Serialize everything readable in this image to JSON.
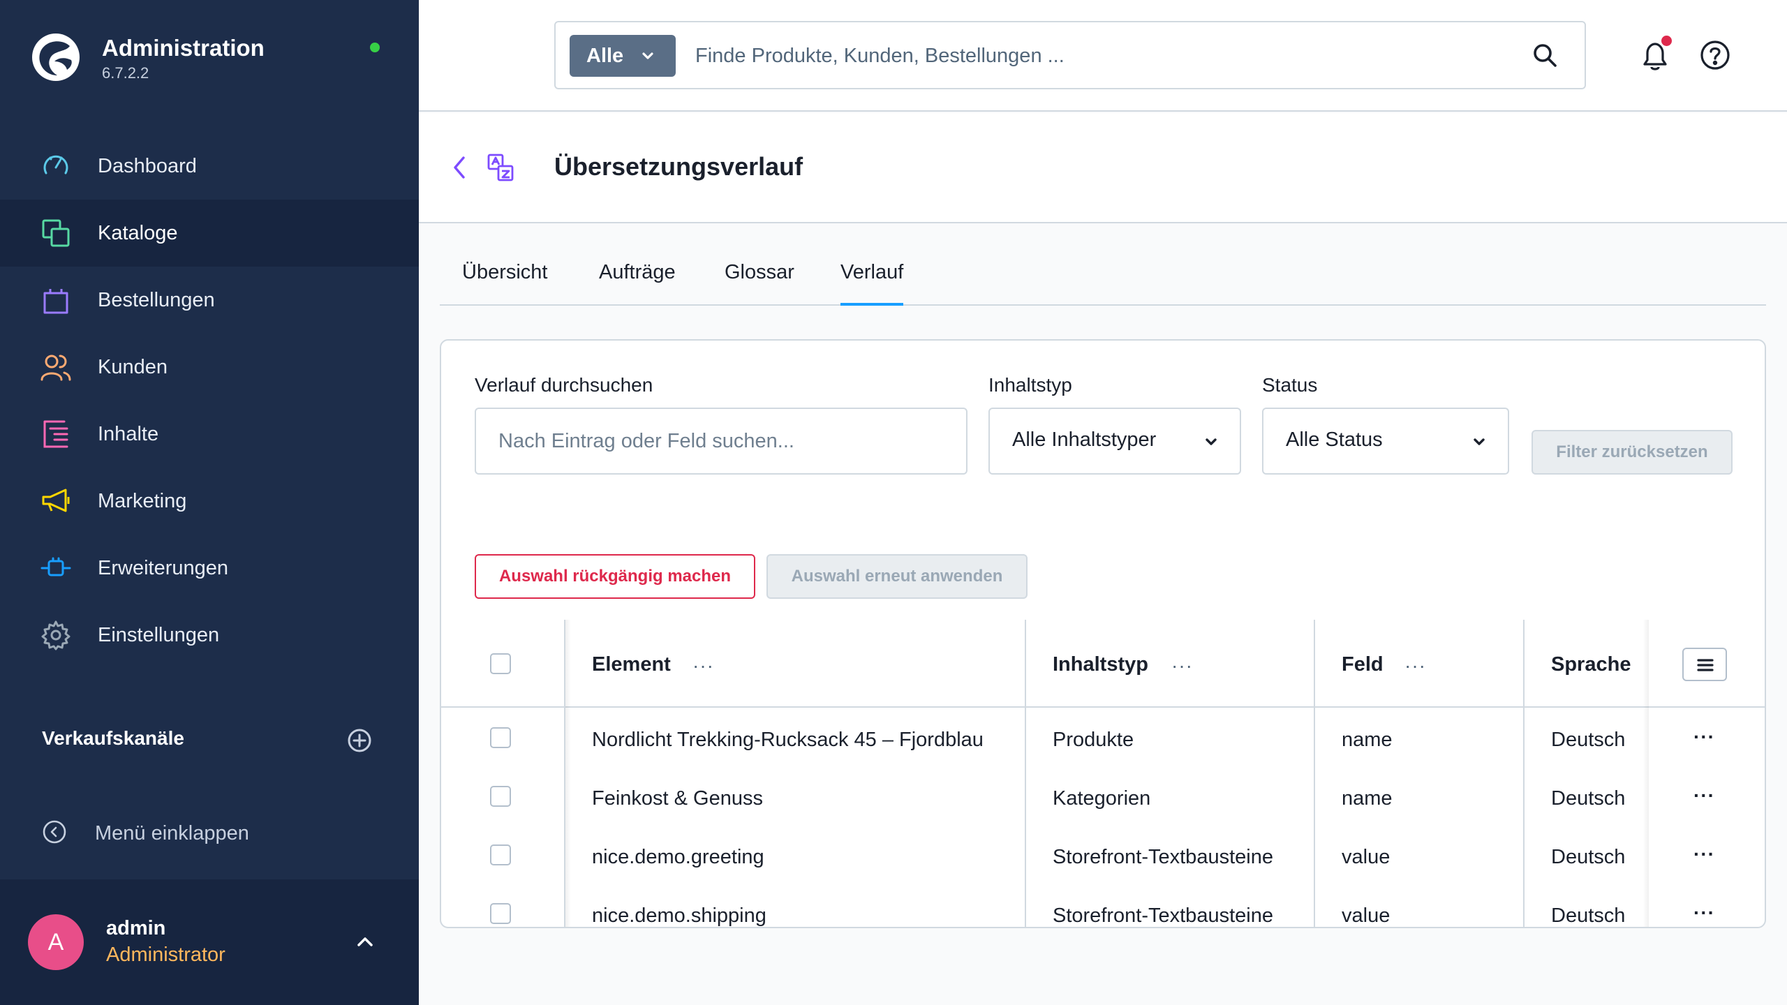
{
  "app": {
    "title": "Administration",
    "version": "6.7.2.2",
    "status_color": "#37d046"
  },
  "sidebar": {
    "items": [
      {
        "label": "Dashboard",
        "icon": "gauge-icon",
        "color": "#5bc9e8"
      },
      {
        "label": "Kataloge",
        "icon": "catalog-icon",
        "color": "#57d9a3",
        "active": true
      },
      {
        "label": "Bestellungen",
        "icon": "shopping-bag-icon",
        "color": "#9a7bff"
      },
      {
        "label": "Kunden",
        "icon": "users-icon",
        "color": "#ffaa72"
      },
      {
        "label": "Inhalte",
        "icon": "content-icon",
        "color": "#ff68b4"
      },
      {
        "label": "Marketing",
        "icon": "megaphone-icon",
        "color": "#ffd700"
      },
      {
        "label": "Erweiterungen",
        "icon": "plug-icon",
        "color": "#189eff"
      },
      {
        "label": "Einstellungen",
        "icon": "gear-icon",
        "color": "#9aa8b5"
      }
    ],
    "channels_title": "Verkaufskanäle",
    "collapse_label": "Menü einklappen",
    "user": {
      "initial": "A",
      "name": "admin",
      "role": "Administrator"
    }
  },
  "topbar": {
    "search_type": "Alle",
    "search_placeholder": "Finde Produkte, Kunden, Bestellungen ..."
  },
  "page": {
    "title": "Übersetzungsverlauf"
  },
  "tabs": [
    {
      "label": "Übersicht"
    },
    {
      "label": "Aufträge"
    },
    {
      "label": "Glossar"
    },
    {
      "label": "Verlauf",
      "active": true
    }
  ],
  "filters": {
    "search_label": "Verlauf durchsuchen",
    "search_placeholder": "Nach Eintrag oder Feld suchen...",
    "content_type_label": "Inhaltstyp",
    "content_type_value": "Alle Inhaltstyper",
    "status_label": "Status",
    "status_value": "Alle Status",
    "reset_label": "Filter zurücksetzen"
  },
  "actions": {
    "undo_label": "Auswahl rückgängig machen",
    "reapply_label": "Auswahl erneut anwenden"
  },
  "table": {
    "columns": [
      "Element",
      "Inhaltstyp",
      "Feld",
      "Sprache"
    ],
    "more": "···",
    "rows": [
      {
        "element": "Nordlicht Trekking-Rucksack 45 – Fjordblau",
        "type": "Produkte",
        "field": "name",
        "language": "Deutsch"
      },
      {
        "element": "Feinkost & Genuss",
        "type": "Kategorien",
        "field": "name",
        "language": "Deutsch"
      },
      {
        "element": "nice.demo.greeting",
        "type": "Storefront-Textbausteine",
        "field": "value",
        "language": "Deutsch"
      },
      {
        "element": "nice.demo.shipping",
        "type": "Storefront-Textbausteine",
        "field": "value",
        "language": "Deutsch"
      }
    ]
  },
  "colors": {
    "sidebar_bg": "#1d2d4a",
    "accent": "#189eff",
    "danger": "#de294c",
    "avatar": "#e84e89",
    "role": "#ffb75d"
  }
}
